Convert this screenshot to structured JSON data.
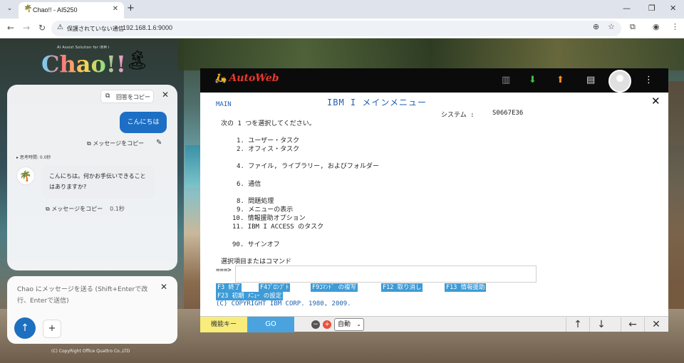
{
  "browser": {
    "tab_title": "Chao!! - AI5250",
    "tab_favicon": "🌴",
    "security_label": "保護されていない通信",
    "url": "192.168.1.6:9000"
  },
  "chao": {
    "tagline": "AI Assist Solution for IBM i",
    "logo_text": "Chao!!",
    "copy_answer_label": "回答をコピー",
    "user_message": "こんにちは",
    "copy_message_label": "メッセージをコピー",
    "thinking_time": "▸ 思考時間: 0.0秒",
    "bot_message": "こんにちは。何かお手伝いできることはありますか?",
    "copy_message_label_2": "メッセージをコピー",
    "response_time": "0.1秒",
    "input_placeholder": "Chao にメッセージを送る (Shift+Enterで改行、Enterで送信)",
    "copyright": "(C) CopyRight Office Quattro Co.,LTD"
  },
  "autoweb": {
    "logo_text": "AutoWeb",
    "icons": [
      "keyboard-icon",
      "download-icon",
      "upload-icon",
      "chat-icon",
      "user-avatar",
      "more-vert-icon"
    ]
  },
  "terminal": {
    "menu_id": "MAIN",
    "title": "IBM I メインメニュー",
    "system_label": "システム :",
    "system_name": "S0667E36",
    "instruction": "次の 1 つを選択してください。",
    "options": [
      "1. ユーザー・タスク",
      "2. オフィス・タスク",
      "4. ファイル, ライブラリー, およびフォルダー",
      "6. 通信",
      "8. 問題処理",
      "9. メニューの表示",
      "10. 情報援助オプション",
      "11. IBM I ACCESS のタスク",
      "90. サインオフ"
    ],
    "command_label": "選択項目またはコマンド",
    "prompt": "===>",
    "fkeys": [
      "F3 終了",
      "F4ﾌﾟﾛﾝﾌﾟﾄ",
      "F9ｺﾏﾝﾄﾞ の複写",
      "F12 取り消し",
      "F13 情報援助",
      "F23 初期 ﾒﾆｭｰ の設定"
    ],
    "copyright": "(C) COPYRIGHT IBM CORP. 1980, 2009."
  },
  "footer": {
    "function_keys_label": "機能キー",
    "go_label": "GO",
    "zoom_value": "自動"
  }
}
